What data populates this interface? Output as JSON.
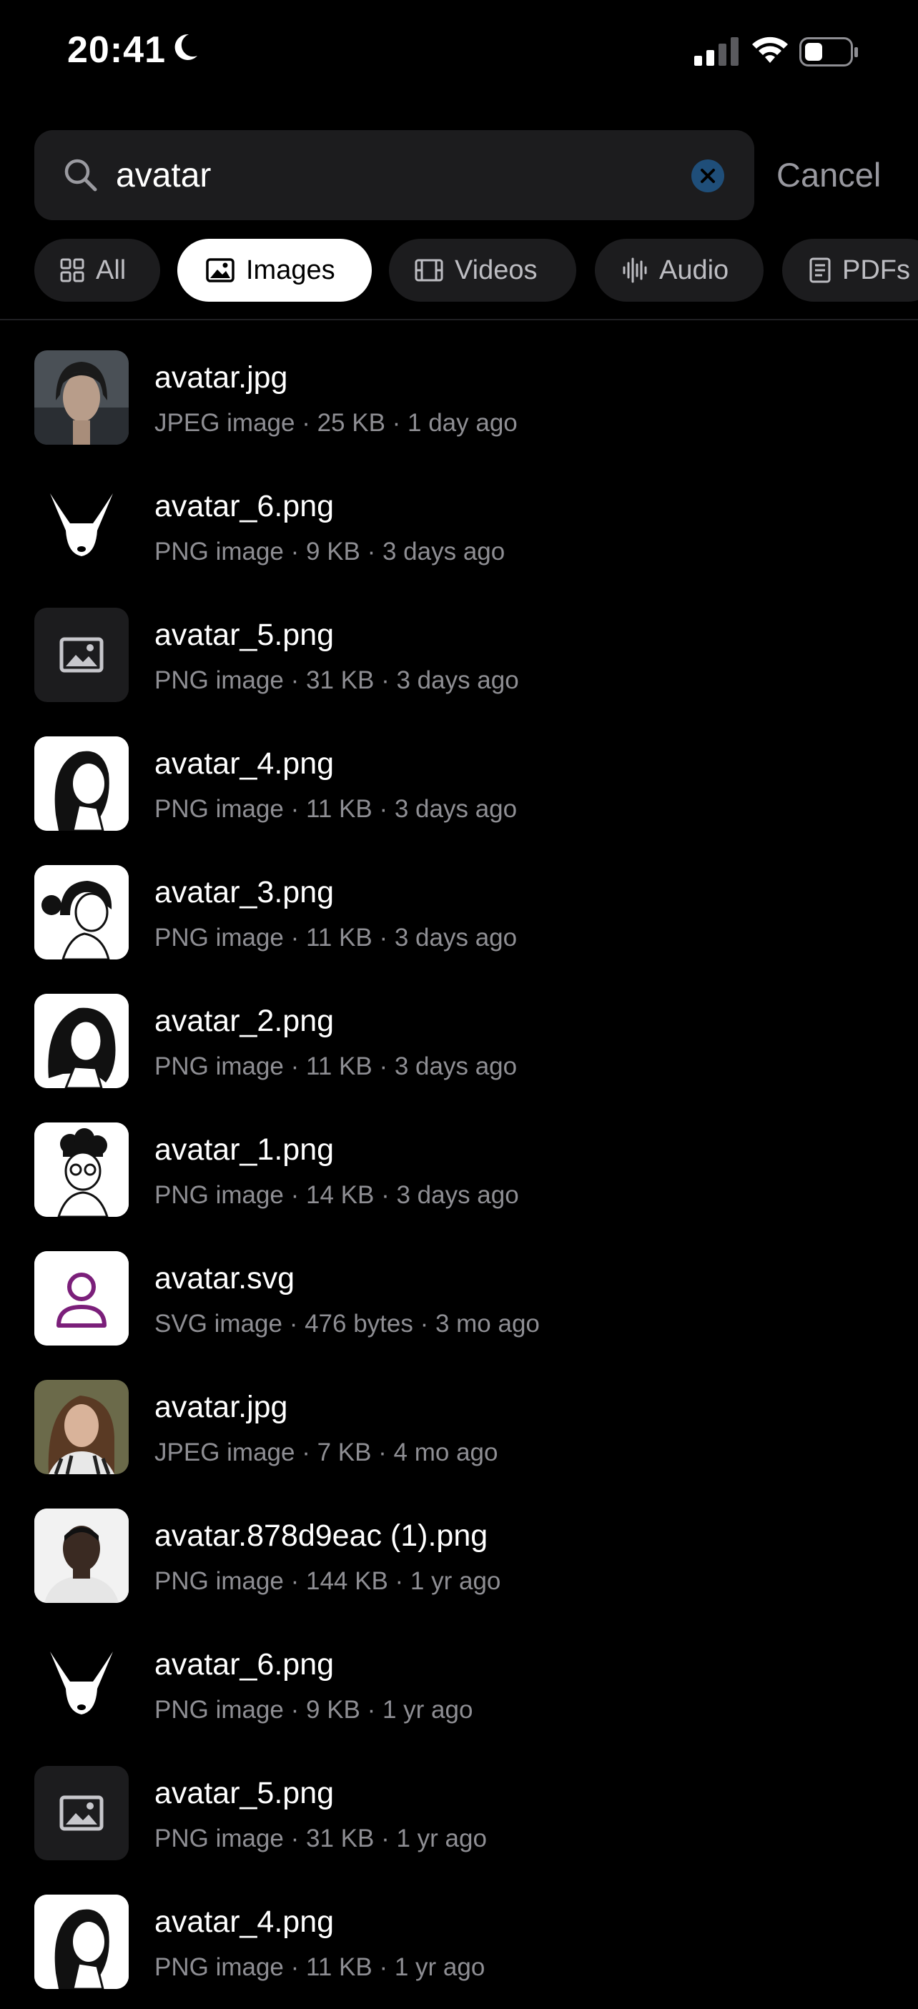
{
  "status": {
    "time": "20:41"
  },
  "search": {
    "value": "avatar",
    "placeholder": "",
    "cancel_label": "Cancel"
  },
  "filters": [
    {
      "label": "All",
      "icon": "grid-icon"
    },
    {
      "label": "Images",
      "icon": "image-icon",
      "active": true
    },
    {
      "label": "Videos",
      "icon": "film-icon"
    },
    {
      "label": "Audio",
      "icon": "waveform-icon"
    },
    {
      "label": "PDFs",
      "icon": "document-icon"
    }
  ],
  "results": [
    {
      "name": "avatar.jpg",
      "meta": "JPEG image · 25 KB · 1 day ago",
      "thumb": "photo-woman-dark"
    },
    {
      "name": "avatar_6.png",
      "meta": "PNG image · 9 KB · 3 days ago",
      "thumb": "rabbit"
    },
    {
      "name": "avatar_5.png",
      "meta": "PNG image · 31 KB · 3 days ago",
      "thumb": "image-placeholder"
    },
    {
      "name": "avatar_4.png",
      "meta": "PNG image · 11 KB · 3 days ago",
      "thumb": "sketch-face"
    },
    {
      "name": "avatar_3.png",
      "meta": "PNG image · 11 KB · 3 days ago",
      "thumb": "sketch-face"
    },
    {
      "name": "avatar_2.png",
      "meta": "PNG image · 11 KB · 3 days ago",
      "thumb": "sketch-face"
    },
    {
      "name": "avatar_1.png",
      "meta": "PNG image · 14 KB · 3 days ago",
      "thumb": "sketch-face"
    },
    {
      "name": "avatar.svg",
      "meta": "SVG image · 476 bytes · 3 mo ago",
      "thumb": "person-outline"
    },
    {
      "name": "avatar.jpg",
      "meta": "JPEG image · 7 KB · 4 mo ago",
      "thumb": "photo-woman-light"
    },
    {
      "name": "avatar.878d9eac (1).png",
      "meta": "PNG image · 144 KB · 1 yr ago",
      "thumb": "photo-man"
    },
    {
      "name": "avatar_6.png",
      "meta": "PNG image · 9 KB · 1 yr ago",
      "thumb": "rabbit"
    },
    {
      "name": "avatar_5.png",
      "meta": "PNG image · 31 KB · 1 yr ago",
      "thumb": "image-placeholder"
    },
    {
      "name": "avatar_4.png",
      "meta": "PNG image · 11 KB · 1 yr ago",
      "thumb": "sketch-face"
    }
  ],
  "colors": {
    "background": "#000000",
    "surface": "#1c1c1e",
    "secondary_text": "#8e8e93",
    "clear_button": "#1f4e79",
    "svg_icon": "#7b1f7a"
  }
}
